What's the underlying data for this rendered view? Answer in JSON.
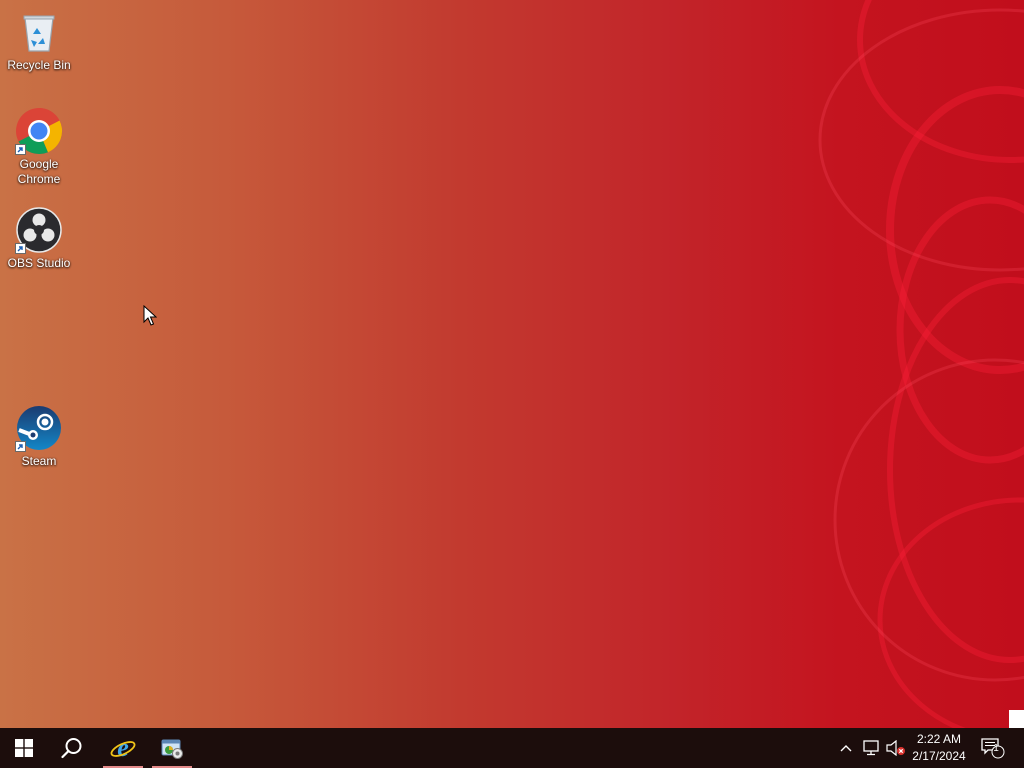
{
  "desktop": {
    "icons": [
      {
        "label": "Recycle Bin",
        "icon": "recycle-bin-icon"
      },
      {
        "label": "Google Chrome",
        "icon": "chrome-icon"
      },
      {
        "label": "OBS Studio",
        "icon": "obs-icon"
      },
      {
        "label": "Steam",
        "icon": "steam-icon"
      }
    ]
  },
  "taskbar": {
    "start_icon": "windows-logo-icon",
    "search_icon": "search-icon",
    "pinned": [
      {
        "icon": "internet-explorer-icon"
      },
      {
        "icon": "control-panel-icon"
      }
    ],
    "tray": {
      "chevron_icon": "chevron-up-icon",
      "network_icon": "network-icon",
      "volume_icon": "volume-muted-icon",
      "time": "2:22 AM",
      "date": "2/17/2024",
      "notifications_icon": "action-center-icon",
      "notification_count": "1"
    }
  },
  "colors": {
    "taskbar": "#1c0d0c",
    "wallpaper_left": "#c97246",
    "wallpaper_right": "#c10e1c"
  }
}
